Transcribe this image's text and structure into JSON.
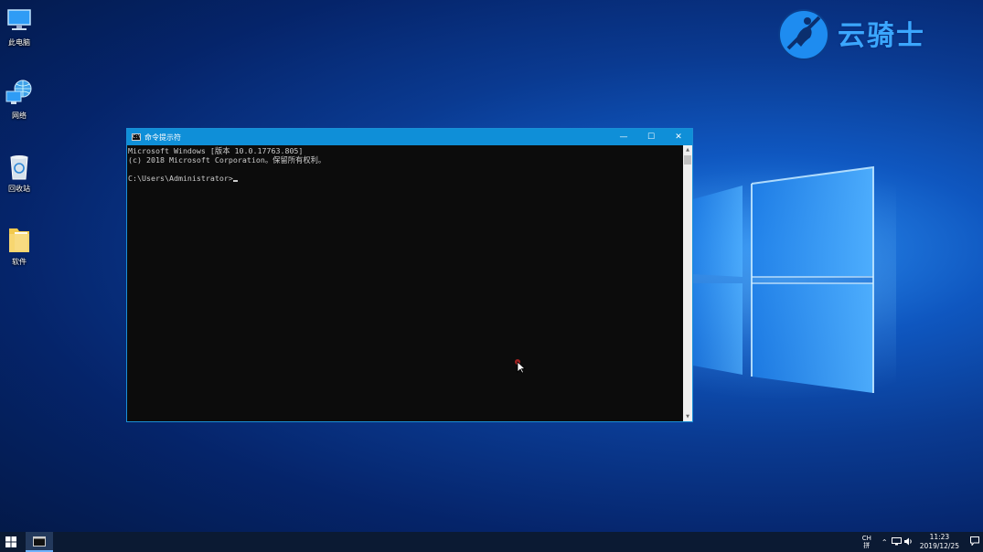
{
  "desktop": {
    "icons": [
      {
        "label": "此电脑",
        "icon": "computer-icon"
      },
      {
        "label": "网络",
        "icon": "network-icon"
      },
      {
        "label": "回收站",
        "icon": "recycle-bin-icon"
      },
      {
        "label": "软件",
        "icon": "folder-icon"
      }
    ],
    "watermark": "云骑士"
  },
  "cmd_window": {
    "title": "命令提示符",
    "icon_text": "C:\\",
    "controls": {
      "minimize": "—",
      "maximize": "☐",
      "close": "✕"
    },
    "lines": [
      "Microsoft Windows [版本 10.0.17763.805]",
      "(c) 2018 Microsoft Corporation。保留所有权利。",
      "",
      "C:\\Users\\Administrator>"
    ]
  },
  "taskbar": {
    "ime": "CH",
    "ime_sub": "拼",
    "tray_icons": [
      "chevron-up-icon",
      "network-icon",
      "volume-icon"
    ],
    "time": "11:23",
    "date": "2019/12/25",
    "notification_icon": "notification-icon"
  },
  "colors": {
    "titlebar": "#0f8fd8",
    "console_bg": "#0c0c0c",
    "console_text": "#cccccc",
    "taskbar": "#0b1a33",
    "watermark": "#3ba7ff"
  }
}
